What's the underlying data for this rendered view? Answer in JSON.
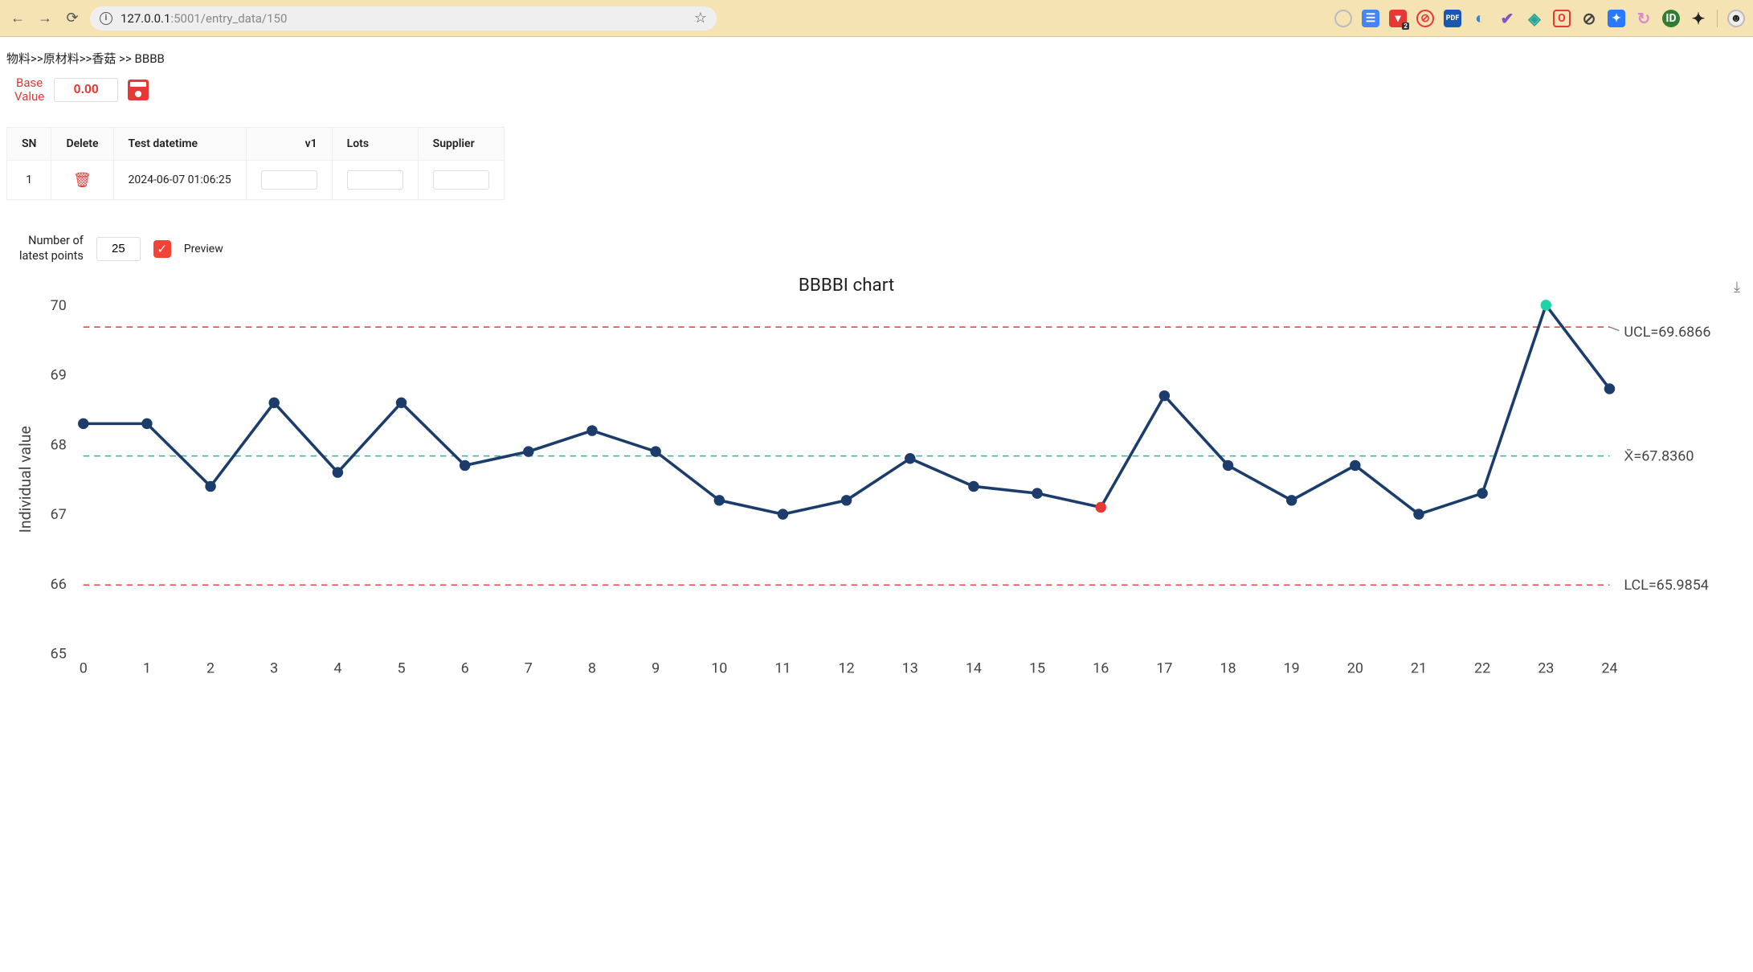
{
  "browser": {
    "url_prefix": "127.0.0.1",
    "url_path": ":5001/entry_data/150"
  },
  "breadcrumb": "物料>>原材料>>香菇 >> BBBB",
  "base_value": {
    "label_line1": "Base",
    "label_line2": "Value",
    "value": "0.00"
  },
  "table": {
    "headers": {
      "sn": "SN",
      "delete": "Delete",
      "datetime": "Test datetime",
      "v1": "v1",
      "lots": "Lots",
      "supplier": "Supplier"
    },
    "rows": [
      {
        "sn": "1",
        "datetime": "2024-06-07 01:06:25",
        "v1": "",
        "lots": "",
        "supplier": ""
      }
    ]
  },
  "preview": {
    "label_line1": "Number of",
    "label_line2": "latest points",
    "value": "25",
    "checkbox_label": "Preview"
  },
  "chart_data": {
    "type": "line",
    "title": "BBBBI chart",
    "ylabel": "Individual value",
    "xlabel": "",
    "ylim": [
      65,
      70
    ],
    "yticks": [
      65,
      66,
      67,
      68,
      69,
      70
    ],
    "xticks": [
      0,
      1,
      2,
      3,
      4,
      5,
      6,
      7,
      8,
      9,
      10,
      11,
      12,
      13,
      14,
      15,
      16,
      17,
      18,
      19,
      20,
      21,
      22,
      23,
      24
    ],
    "ucl": 69.6866,
    "center_line": 67.836,
    "lcl": 65.9854,
    "ucl_label": "UCL=69.6866",
    "center_label": "X̄=67.8360",
    "lcl_label": "LCL=65.9854",
    "series": [
      {
        "name": "Individual value",
        "x": [
          0,
          1,
          2,
          3,
          4,
          5,
          6,
          7,
          8,
          9,
          10,
          11,
          12,
          13,
          14,
          15,
          16,
          17,
          18,
          19,
          20,
          21,
          22,
          23,
          24
        ],
        "values": [
          68.3,
          68.3,
          67.4,
          68.6,
          67.6,
          68.6,
          67.7,
          67.9,
          68.2,
          67.9,
          67.2,
          67.0,
          67.2,
          67.8,
          67.4,
          67.3,
          67.1,
          68.7,
          67.7,
          67.2,
          67.7,
          67.0,
          67.3,
          70.0,
          68.8
        ],
        "special_points": {
          "16": "red",
          "23": "green"
        }
      }
    ]
  }
}
